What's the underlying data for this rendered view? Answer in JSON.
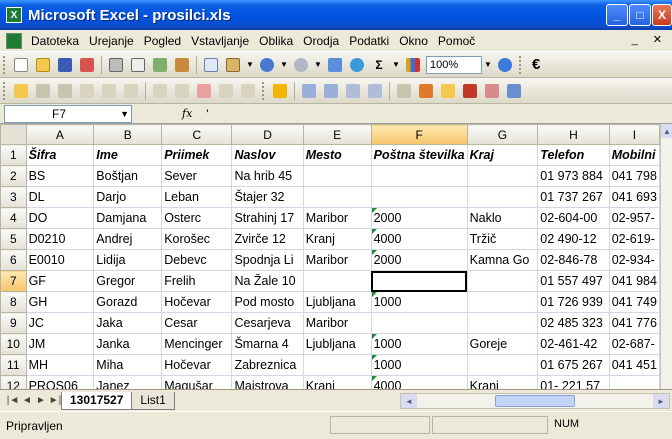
{
  "window": {
    "title": "Microsoft Excel - prosilci.xls",
    "min_label": "_",
    "max_label": "□",
    "close_label": "X"
  },
  "menu": {
    "items": [
      "Datoteka",
      "Urejanje",
      "Pogled",
      "Vstavljanje",
      "Oblika",
      "Orodja",
      "Podatki",
      "Okno",
      "Pomoč"
    ],
    "right_controls": "_ ✕"
  },
  "toolbar": {
    "zoom": "100%",
    "sigma": "Σ",
    "euro": "€"
  },
  "formula_bar": {
    "name_box": "F7",
    "fx_label": "fx",
    "content": "'"
  },
  "sheet": {
    "columns": [
      "A",
      "B",
      "C",
      "D",
      "E",
      "F",
      "G",
      "H",
      "I"
    ],
    "rows": [
      [
        "Šifra",
        "Ime",
        "Priimek",
        "Naslov",
        "Mesto",
        "Poštna številka",
        "Kraj",
        "Telefon",
        "Mobilni"
      ],
      [
        "BS",
        "Boštjan",
        "Sever",
        "Na hrib 45",
        "",
        "",
        "",
        "01 973 884",
        "041 798"
      ],
      [
        "DL",
        "Darjo",
        "Leban",
        "Štajer 32",
        "",
        "",
        "",
        "01 737 267",
        "041 693"
      ],
      [
        "DO",
        "Damjana",
        "Osterc",
        "Strahinj 17",
        "Maribor",
        "2000",
        "Naklo",
        "02-604-00",
        "02-957-"
      ],
      [
        "D0210",
        "Andrej",
        "Korošec",
        "Zvirče 12",
        "Kranj",
        "4000",
        "Tržič",
        "02 490-12",
        "02-619-"
      ],
      [
        "E0010",
        "Lidija",
        "Debevc",
        "Spodnja Li",
        "Maribor",
        "2000",
        "Kamna Go",
        "02-846-78",
        "02-934-"
      ],
      [
        "GF",
        "Gregor",
        "Frelih",
        "Na Žale 10",
        "",
        "",
        "",
        "01 557 497",
        "041 984"
      ],
      [
        "GH",
        "Gorazd",
        "Hočevar",
        "Pod mosto",
        "Ljubljana",
        "1000",
        "",
        "01 726 939",
        "041 749"
      ],
      [
        "JC",
        "Jaka",
        "Cesar",
        "Cesarjeva",
        "Maribor",
        "",
        "",
        "02 485 323",
        "041 776"
      ],
      [
        "JM",
        "Janka",
        "Mencinger",
        "Šmarna 4",
        "Ljubljana",
        "1000",
        "Goreje",
        "02-461-42",
        "02-687-"
      ],
      [
        "MH",
        "Miha",
        "Hočevar",
        "Zabreznica",
        "",
        "1000",
        "",
        "01 675 267",
        "041 451"
      ],
      [
        "PROS06",
        "Janez",
        "Magušar",
        "Majstrova",
        "Kranj",
        "4000",
        "Kranj",
        "01- 221 57",
        ""
      ]
    ],
    "number_cells": [
      "4-5",
      "5-5",
      "6-5",
      "8-5",
      "10-5",
      "11-5",
      "12-5"
    ],
    "active_cell": "7-5"
  },
  "tabs": {
    "nav": [
      "|◄",
      "◄",
      "►",
      "►|"
    ],
    "sheets": [
      "13017527",
      "List1"
    ]
  },
  "status": {
    "text": "Pripravljen",
    "num": "NUM"
  }
}
